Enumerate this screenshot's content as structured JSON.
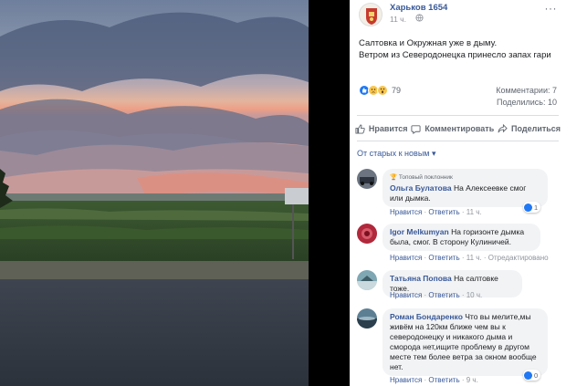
{
  "page": {
    "name": "Харьков 1654",
    "time": "11 ч.",
    "more": "···"
  },
  "post": {
    "line1": "Салтовка и Окружная уже в дыму.",
    "line2": "Ветром из Северодонецка принесло запах гари"
  },
  "stats": {
    "reactions_count": "79",
    "comments": "Комментарии: 7",
    "shares": "Поделились: 10"
  },
  "actions": {
    "like": "Нравится",
    "comment": "Комментировать",
    "share": "Поделиться"
  },
  "sort": {
    "label": "От старых к новым ▾"
  },
  "comments": [
    {
      "badge": "🏆 Топовый поклонник",
      "name": "Ольга Булатова",
      "text1": " На Алексеевке смог",
      "text2": "или дымка.",
      "like": "Нравится",
      "reply": "Ответить",
      "time": "11 ч.",
      "reaction_count": "1"
    },
    {
      "name": "Igor Melkumyan",
      "text1": " На горизонте дымка",
      "text2": "была, смог. В сторону Кулиничей.",
      "like": "Нравится",
      "reply": "Ответить",
      "time": "11 ч.",
      "edited": "Отредактировано"
    },
    {
      "name": "Татьяна Попова",
      "text1": " На салтовке тоже.",
      "like": "Нравится",
      "reply": "Ответить",
      "time": "10 ч."
    },
    {
      "name": "Роман Бондаренко",
      "text1": " Что вы мелите,мы",
      "text2": "живём на 120км ближе чем вы к",
      "text3": "северодонецку и никакого дыма и",
      "text4": "сморода нет,ищите проблему в другом",
      "text5": "месте тем более ветра за окном вообще",
      "text6": "нет.",
      "like": "Нравится",
      "reply": "Ответить",
      "time": "9 ч.",
      "reaction_count": "0"
    }
  ],
  "colors": {
    "link": "#385898",
    "muted": "#606770",
    "like_blue": "#2078f4"
  }
}
